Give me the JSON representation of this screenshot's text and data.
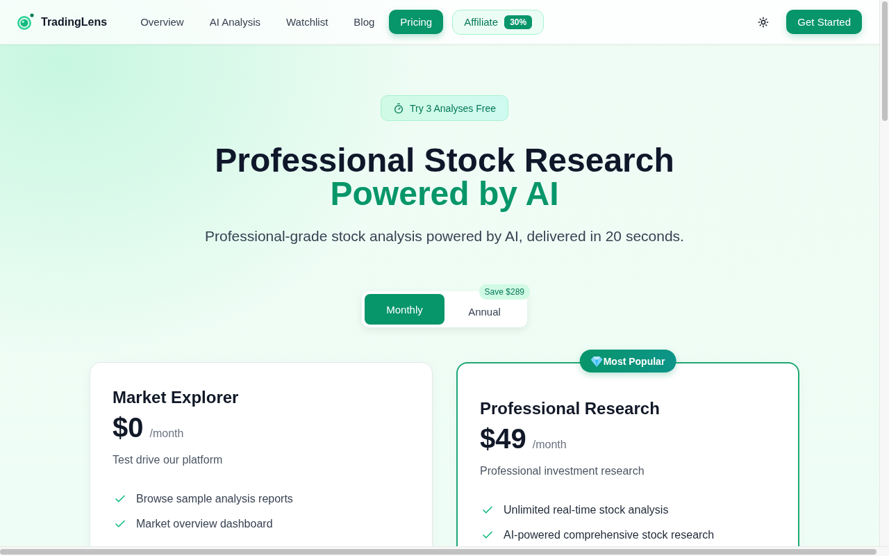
{
  "nav": {
    "brand": "TradingLens",
    "links": [
      {
        "label": "Overview",
        "selected": false
      },
      {
        "label": "AI Analysis",
        "selected": false
      },
      {
        "label": "Watchlist",
        "selected": false
      },
      {
        "label": "Blog",
        "selected": false
      },
      {
        "label": "Pricing",
        "selected": true
      }
    ],
    "affiliate": {
      "label": "Affiliate",
      "badge": "30%"
    },
    "cta": "Get Started"
  },
  "hero": {
    "badge": "Try 3 Analyses Free",
    "title": "Professional Stock Research",
    "title_accent": "Powered by AI",
    "subtitle": "Professional-grade stock analysis powered by AI, delivered in 20 seconds."
  },
  "billing_toggle": {
    "options": [
      {
        "label": "Monthly",
        "selected": true
      },
      {
        "label": "Annual",
        "selected": false
      }
    ],
    "save_badge": "Save $289"
  },
  "plans": [
    {
      "name": "Market Explorer",
      "price": "$0",
      "period": "/month",
      "description": "Test drive our platform",
      "featured": false,
      "features": [
        "Browse sample analysis reports",
        "Market overview dashboard"
      ]
    },
    {
      "name": "Professional Research",
      "price": "$49",
      "period": "/month",
      "description": "Professional investment research",
      "featured": true,
      "ribbon": "Most Popular",
      "features": [
        "Unlimited real-time stock analysis",
        "AI-powered comprehensive stock research"
      ]
    }
  ]
}
